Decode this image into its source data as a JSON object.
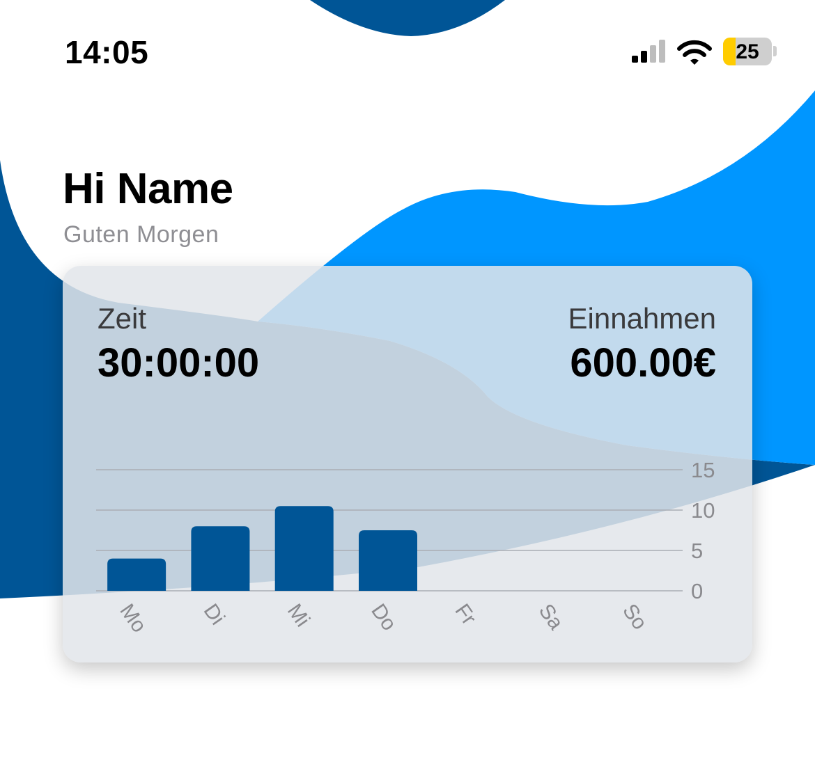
{
  "status_bar": {
    "time": "14:05",
    "battery_level": "25",
    "icons": [
      "cellular-signal-icon",
      "wifi-icon",
      "battery-icon"
    ]
  },
  "greeting": {
    "title": "Hi Name",
    "subtitle": "Guten Morgen"
  },
  "stats": {
    "time_label": "Zeit",
    "time_value": "30:00:00",
    "income_label": "Einnahmen",
    "income_value": "600.00€"
  },
  "colors": {
    "dark_blue": "#005596",
    "light_blue": "#0096ff",
    "bar_color": "#005596"
  },
  "chart_data": {
    "type": "bar",
    "categories": [
      "Mo",
      "Di",
      "Mi",
      "Do",
      "Fr",
      "Sa",
      "So"
    ],
    "values": [
      4,
      8,
      10.5,
      7.5,
      0,
      0,
      0
    ],
    "ylim": [
      0,
      15
    ],
    "yticks": [
      0,
      5,
      10,
      15
    ],
    "grid": true,
    "y_axis_position": "right",
    "xlabel_rotation": "rotated"
  }
}
